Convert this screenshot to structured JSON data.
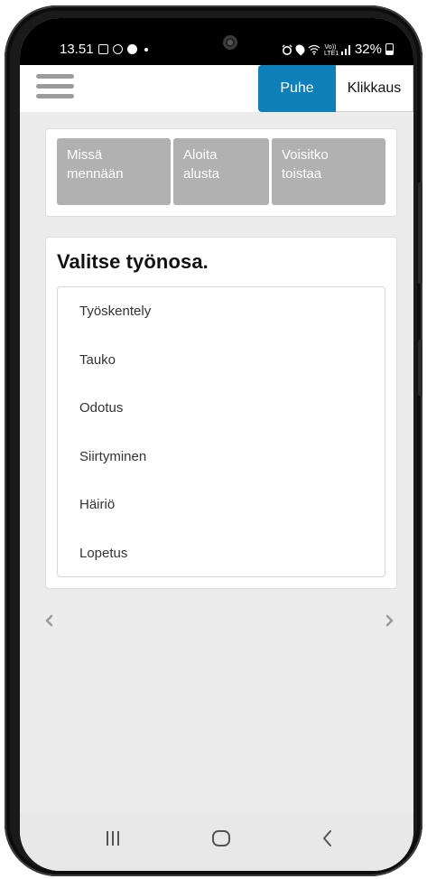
{
  "status_bar": {
    "time": "13.51",
    "lte_label": "Vo)) LTE1",
    "battery": "32%"
  },
  "app_bar": {
    "menu_icon": "hamburger-menu-icon",
    "mode_tabs": [
      {
        "label": "Puhe",
        "active": true
      },
      {
        "label": "Klikkaus",
        "active": false
      }
    ],
    "accent_color": "#0e7fb9"
  },
  "quick_actions": [
    {
      "line1": "Missä",
      "line2": "mennään"
    },
    {
      "line1": "Aloita",
      "line2": "alusta"
    },
    {
      "line1": "Voisitko",
      "line2": "toistaa"
    }
  ],
  "task_section": {
    "title": "Valitse työnosa.",
    "items": [
      "Työskentely",
      "Tauko",
      "Odotus",
      "Siirtyminen",
      "Häiriö",
      "Lopetus"
    ]
  },
  "carousel": {
    "prev_icon": "chevron-left-icon",
    "next_icon": "chevron-right-icon"
  },
  "nav_bar": {
    "recents_icon": "recents-icon",
    "home_icon": "home-icon",
    "back_icon": "back-icon"
  }
}
